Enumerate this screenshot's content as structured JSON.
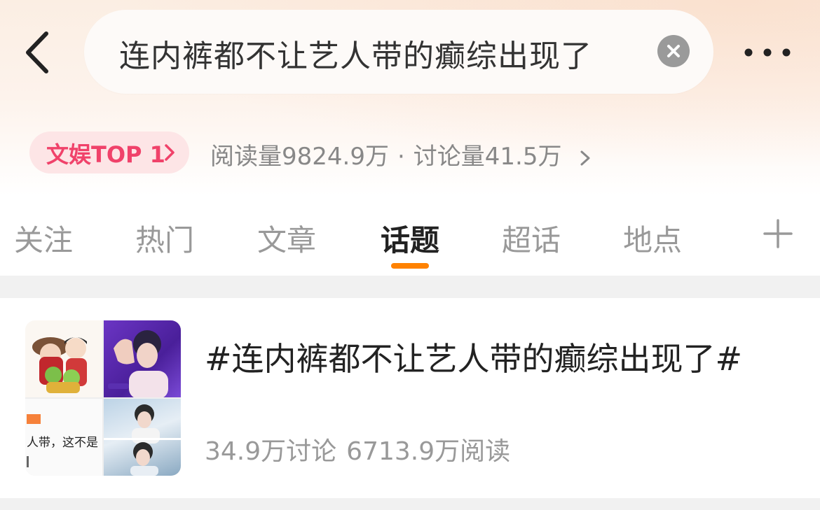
{
  "header": {
    "search_query": "连内裤都不让艺人带的癫综出现了"
  },
  "rank": {
    "badge_label": "文娱TOP 1",
    "reads_label": "阅读量",
    "reads_value": "9824.9万",
    "separator": "·",
    "discuss_label": "讨论量",
    "discuss_value": "41.5万"
  },
  "tabs": [
    {
      "label": "关注",
      "active": false
    },
    {
      "label": "热门",
      "active": false
    },
    {
      "label": "文章",
      "active": false
    },
    {
      "label": "话题",
      "active": true
    },
    {
      "label": "超话",
      "active": false
    },
    {
      "label": "地点",
      "active": false
    }
  ],
  "topic": {
    "title": "#连内裤都不让艺人带的癫综出现了#",
    "discussions": "34.9万讨论",
    "reads": "6713.9万阅读",
    "thumb_caption": "人带，这不是"
  },
  "colors": {
    "accent_orange": "#ff8200",
    "badge_pink": "#f0426a",
    "badge_bg": "#fde5e6"
  },
  "icons": {
    "back": "chevron-left-icon",
    "clear": "close-circle-icon",
    "more": "more-dots-icon",
    "add": "plus-icon"
  }
}
